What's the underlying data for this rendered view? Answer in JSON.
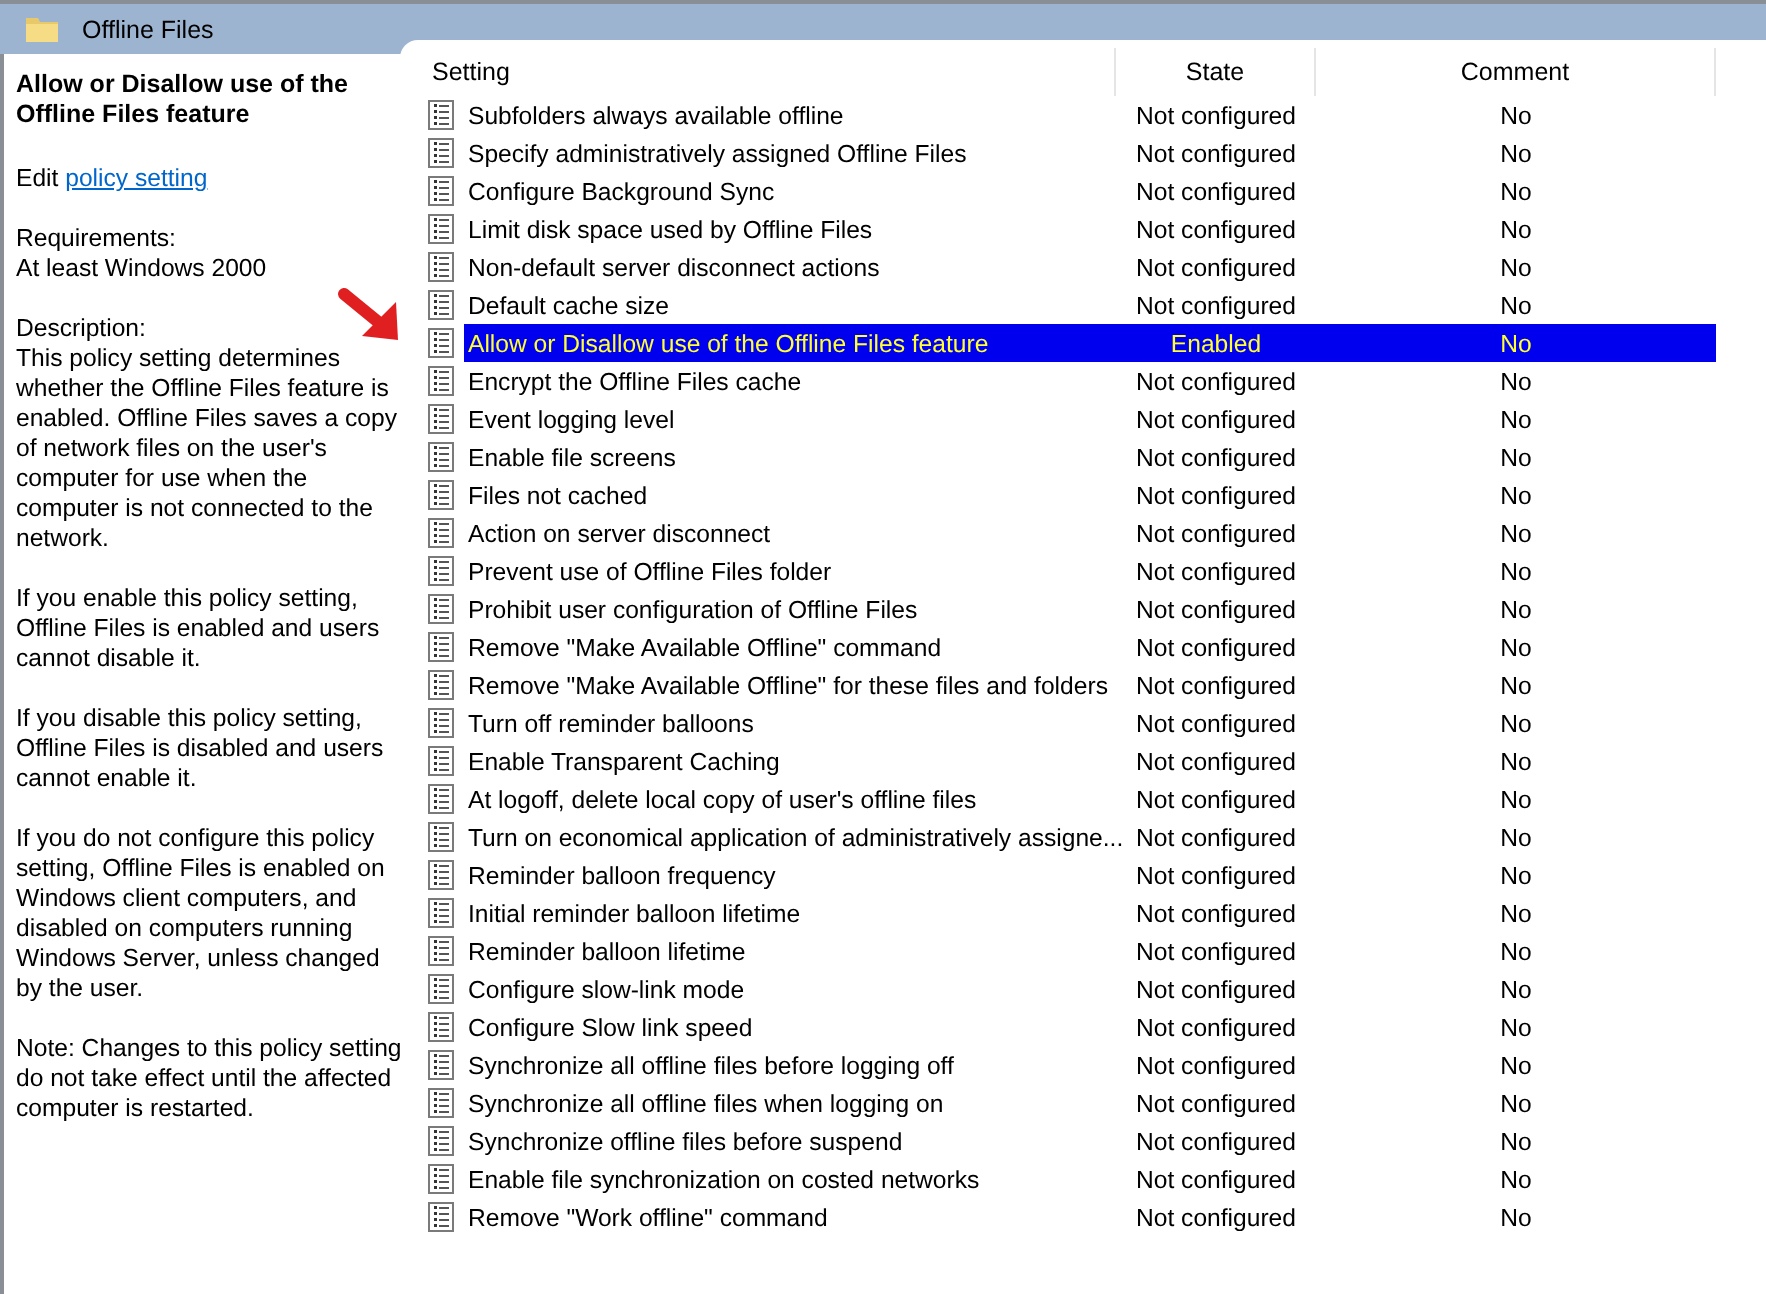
{
  "window": {
    "title": "Offline Files"
  },
  "details": {
    "title": "Allow or Disallow use of the Offline Files feature",
    "edit_prefix": "Edit",
    "edit_link": "policy setting ",
    "requirements_label": "Requirements:",
    "requirements": "At least Windows 2000",
    "description_label": "Description:",
    "paragraphs": [
      "This policy setting determines whether the Offline Files feature is enabled. Offline Files saves a copy of network files on the user's computer for use when the computer is not connected to the network.",
      "If you enable this policy setting, Offline Files is enabled and users cannot disable it.",
      "If you disable this policy setting, Offline Files is disabled and users cannot enable it.",
      "If you do not configure this policy setting, Offline Files is enabled on Windows client computers, and disabled on computers running Windows Server, unless changed by the user.",
      "Note: Changes to this policy setting do not take effect until the affected computer is restarted."
    ]
  },
  "table": {
    "columns": [
      "Setting",
      "State",
      "Comment"
    ],
    "rows": [
      {
        "setting": "Subfolders always available offline",
        "state": "Not configured",
        "comment": "No",
        "selected": false
      },
      {
        "setting": "Specify administratively assigned Offline Files",
        "state": "Not configured",
        "comment": "No",
        "selected": false
      },
      {
        "setting": "Configure Background Sync",
        "state": "Not configured",
        "comment": "No",
        "selected": false
      },
      {
        "setting": "Limit disk space used by Offline Files",
        "state": "Not configured",
        "comment": "No",
        "selected": false
      },
      {
        "setting": "Non-default server disconnect actions",
        "state": "Not configured",
        "comment": "No",
        "selected": false
      },
      {
        "setting": "Default cache size",
        "state": "Not configured",
        "comment": "No",
        "selected": false
      },
      {
        "setting": "Allow or Disallow use of the Offline Files feature",
        "state": "Enabled",
        "comment": "No",
        "selected": true
      },
      {
        "setting": "Encrypt the Offline Files cache",
        "state": "Not configured",
        "comment": "No",
        "selected": false
      },
      {
        "setting": "Event logging level",
        "state": "Not configured",
        "comment": "No",
        "selected": false
      },
      {
        "setting": "Enable file screens",
        "state": "Not configured",
        "comment": "No",
        "selected": false
      },
      {
        "setting": "Files not cached",
        "state": "Not configured",
        "comment": "No",
        "selected": false
      },
      {
        "setting": "Action on server disconnect",
        "state": "Not configured",
        "comment": "No",
        "selected": false
      },
      {
        "setting": "Prevent use of Offline Files folder",
        "state": "Not configured",
        "comment": "No",
        "selected": false
      },
      {
        "setting": "Prohibit user configuration of Offline Files",
        "state": "Not configured",
        "comment": "No",
        "selected": false
      },
      {
        "setting": "Remove \"Make Available Offline\" command",
        "state": "Not configured",
        "comment": "No",
        "selected": false
      },
      {
        "setting": "Remove \"Make Available Offline\" for these files and folders",
        "state": "Not configured",
        "comment": "No",
        "selected": false
      },
      {
        "setting": "Turn off reminder balloons",
        "state": "Not configured",
        "comment": "No",
        "selected": false
      },
      {
        "setting": "Enable Transparent Caching",
        "state": "Not configured",
        "comment": "No",
        "selected": false
      },
      {
        "setting": "At logoff, delete local copy of user's offline files",
        "state": "Not configured",
        "comment": "No",
        "selected": false
      },
      {
        "setting": "Turn on economical application of administratively assigne...",
        "state": "Not configured",
        "comment": "No",
        "selected": false
      },
      {
        "setting": "Reminder balloon frequency",
        "state": "Not configured",
        "comment": "No",
        "selected": false
      },
      {
        "setting": "Initial reminder balloon lifetime",
        "state": "Not configured",
        "comment": "No",
        "selected": false
      },
      {
        "setting": "Reminder balloon lifetime",
        "state": "Not configured",
        "comment": "No",
        "selected": false
      },
      {
        "setting": "Configure slow-link mode",
        "state": "Not configured",
        "comment": "No",
        "selected": false
      },
      {
        "setting": "Configure Slow link speed",
        "state": "Not configured",
        "comment": "No",
        "selected": false
      },
      {
        "setting": "Synchronize all offline files before logging off",
        "state": "Not configured",
        "comment": "No",
        "selected": false
      },
      {
        "setting": "Synchronize all offline files when logging on",
        "state": "Not configured",
        "comment": "No",
        "selected": false
      },
      {
        "setting": "Synchronize offline files before suspend",
        "state": "Not configured",
        "comment": "No",
        "selected": false
      },
      {
        "setting": "Enable file synchronization on costed networks",
        "state": "Not configured",
        "comment": "No",
        "selected": false
      },
      {
        "setting": "Remove \"Work offline\" command",
        "state": "Not configured",
        "comment": "No",
        "selected": false
      }
    ]
  }
}
